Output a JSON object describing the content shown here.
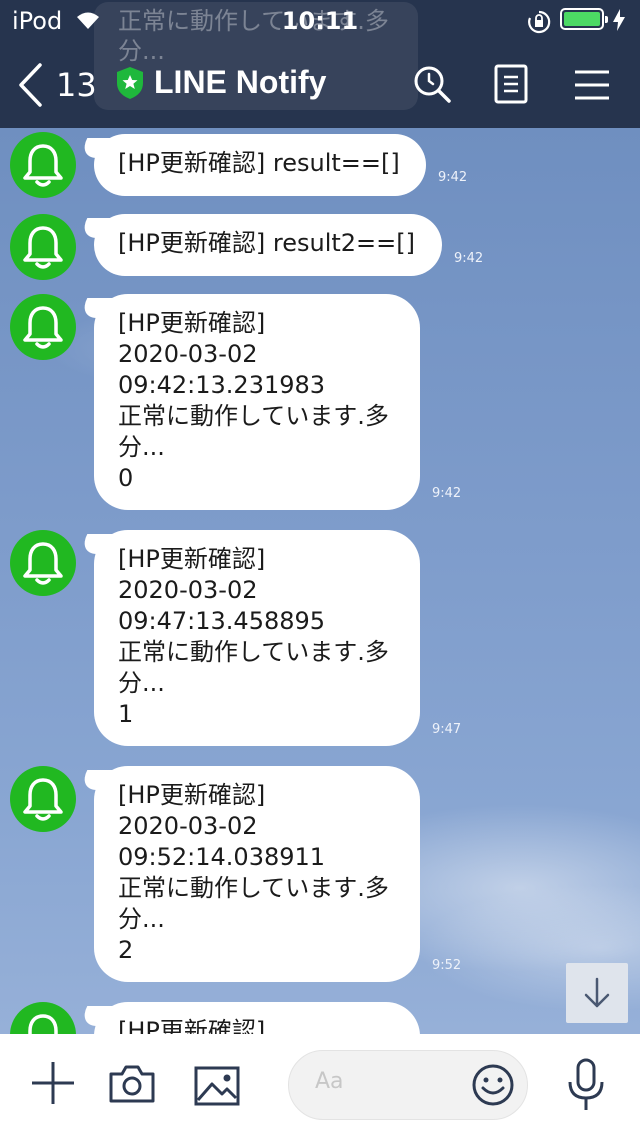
{
  "status": {
    "carrier": "iPod",
    "time": "10:11"
  },
  "header": {
    "back_count": "13",
    "title": "LINE Notify"
  },
  "ghost_notification": {
    "text": "正常に動作しています.多分..."
  },
  "messages": [
    {
      "text": "[HP更新確認] result==[]",
      "time": "9:42"
    },
    {
      "text": "[HP更新確認] result2==[]",
      "time": "9:42"
    },
    {
      "text": "[HP更新確認]\n2020-03-02\n09:42:13.231983\n正常に動作しています.多\n分...\n0",
      "time": "9:42"
    },
    {
      "text": "[HP更新確認]\n2020-03-02\n09:47:13.458895\n正常に動作しています.多\n分...\n1",
      "time": "9:47"
    },
    {
      "text": "[HP更新確認]\n2020-03-02\n09:52:14.038911\n正常に動作しています.多\n分...\n2",
      "time": "9:52"
    },
    {
      "text": "[HP更新確認]",
      "time": ""
    }
  ],
  "composer": {
    "placeholder": "Aa"
  },
  "colors": {
    "header_bg": "#26344e",
    "avatar_green": "#21b821",
    "battery_green": "#4cd964"
  }
}
